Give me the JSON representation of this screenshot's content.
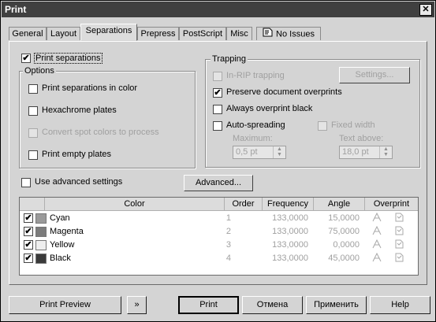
{
  "window": {
    "title": "Print",
    "close_glyph": "✕"
  },
  "tabs": [
    {
      "label": "General"
    },
    {
      "label": "Layout"
    },
    {
      "label": "Separations"
    },
    {
      "label": "Prepress"
    },
    {
      "label": "PostScript"
    },
    {
      "label": "Misc"
    },
    {
      "label": "No Issues",
      "icon": "issues-icon"
    }
  ],
  "print_separations": {
    "label": "Print separations",
    "checked": true
  },
  "options": {
    "title": "Options",
    "items": [
      {
        "label": "Print separations in color",
        "checked": false,
        "enabled": true
      },
      {
        "label": "Hexachrome plates",
        "checked": false,
        "enabled": true
      },
      {
        "label": "Convert spot colors to process",
        "checked": false,
        "enabled": false
      },
      {
        "label": "Print empty plates",
        "checked": false,
        "enabled": true
      }
    ]
  },
  "trapping": {
    "title": "Trapping",
    "in_rip": {
      "label": "In-RIP trapping",
      "checked": false,
      "enabled": false
    },
    "settings_button": "Settings...",
    "preserve": {
      "label": "Preserve document overprints",
      "checked": true
    },
    "always_overprint": {
      "label": "Always overprint black",
      "checked": false
    },
    "auto_spreading": {
      "label": "Auto-spreading",
      "checked": false
    },
    "fixed_width": {
      "label": "Fixed width",
      "checked": false,
      "enabled": false
    },
    "maximum_label": "Maximum:",
    "maximum_value": "0,5 pt",
    "text_above_label": "Text above:",
    "text_above_value": "18,0 pt"
  },
  "advanced": {
    "checkbox_label": "Use advanced settings",
    "button_label": "Advanced..."
  },
  "table": {
    "headers": [
      "Color",
      "Order",
      "Frequency",
      "Angle",
      "Overprint"
    ],
    "rows": [
      {
        "checked": true,
        "color_name": "Cyan",
        "swatch": "#9a9a9a",
        "order": "1",
        "frequency": "133,0000",
        "angle": "15,0000"
      },
      {
        "checked": true,
        "color_name": "Magenta",
        "swatch": "#7c7c7c",
        "order": "2",
        "frequency": "133,0000",
        "angle": "75,0000"
      },
      {
        "checked": true,
        "color_name": "Yellow",
        "swatch": "#eeeeee",
        "order": "3",
        "frequency": "133,0000",
        "angle": "0,0000"
      },
      {
        "checked": true,
        "color_name": "Black",
        "swatch": "#3a3a3a",
        "order": "4",
        "frequency": "133,0000",
        "angle": "45,0000"
      }
    ]
  },
  "footer": {
    "print_preview": "Print Preview",
    "expand_glyph": "»",
    "print": "Print",
    "cancel": "Отмена",
    "apply": "Применить",
    "help": "Help"
  }
}
